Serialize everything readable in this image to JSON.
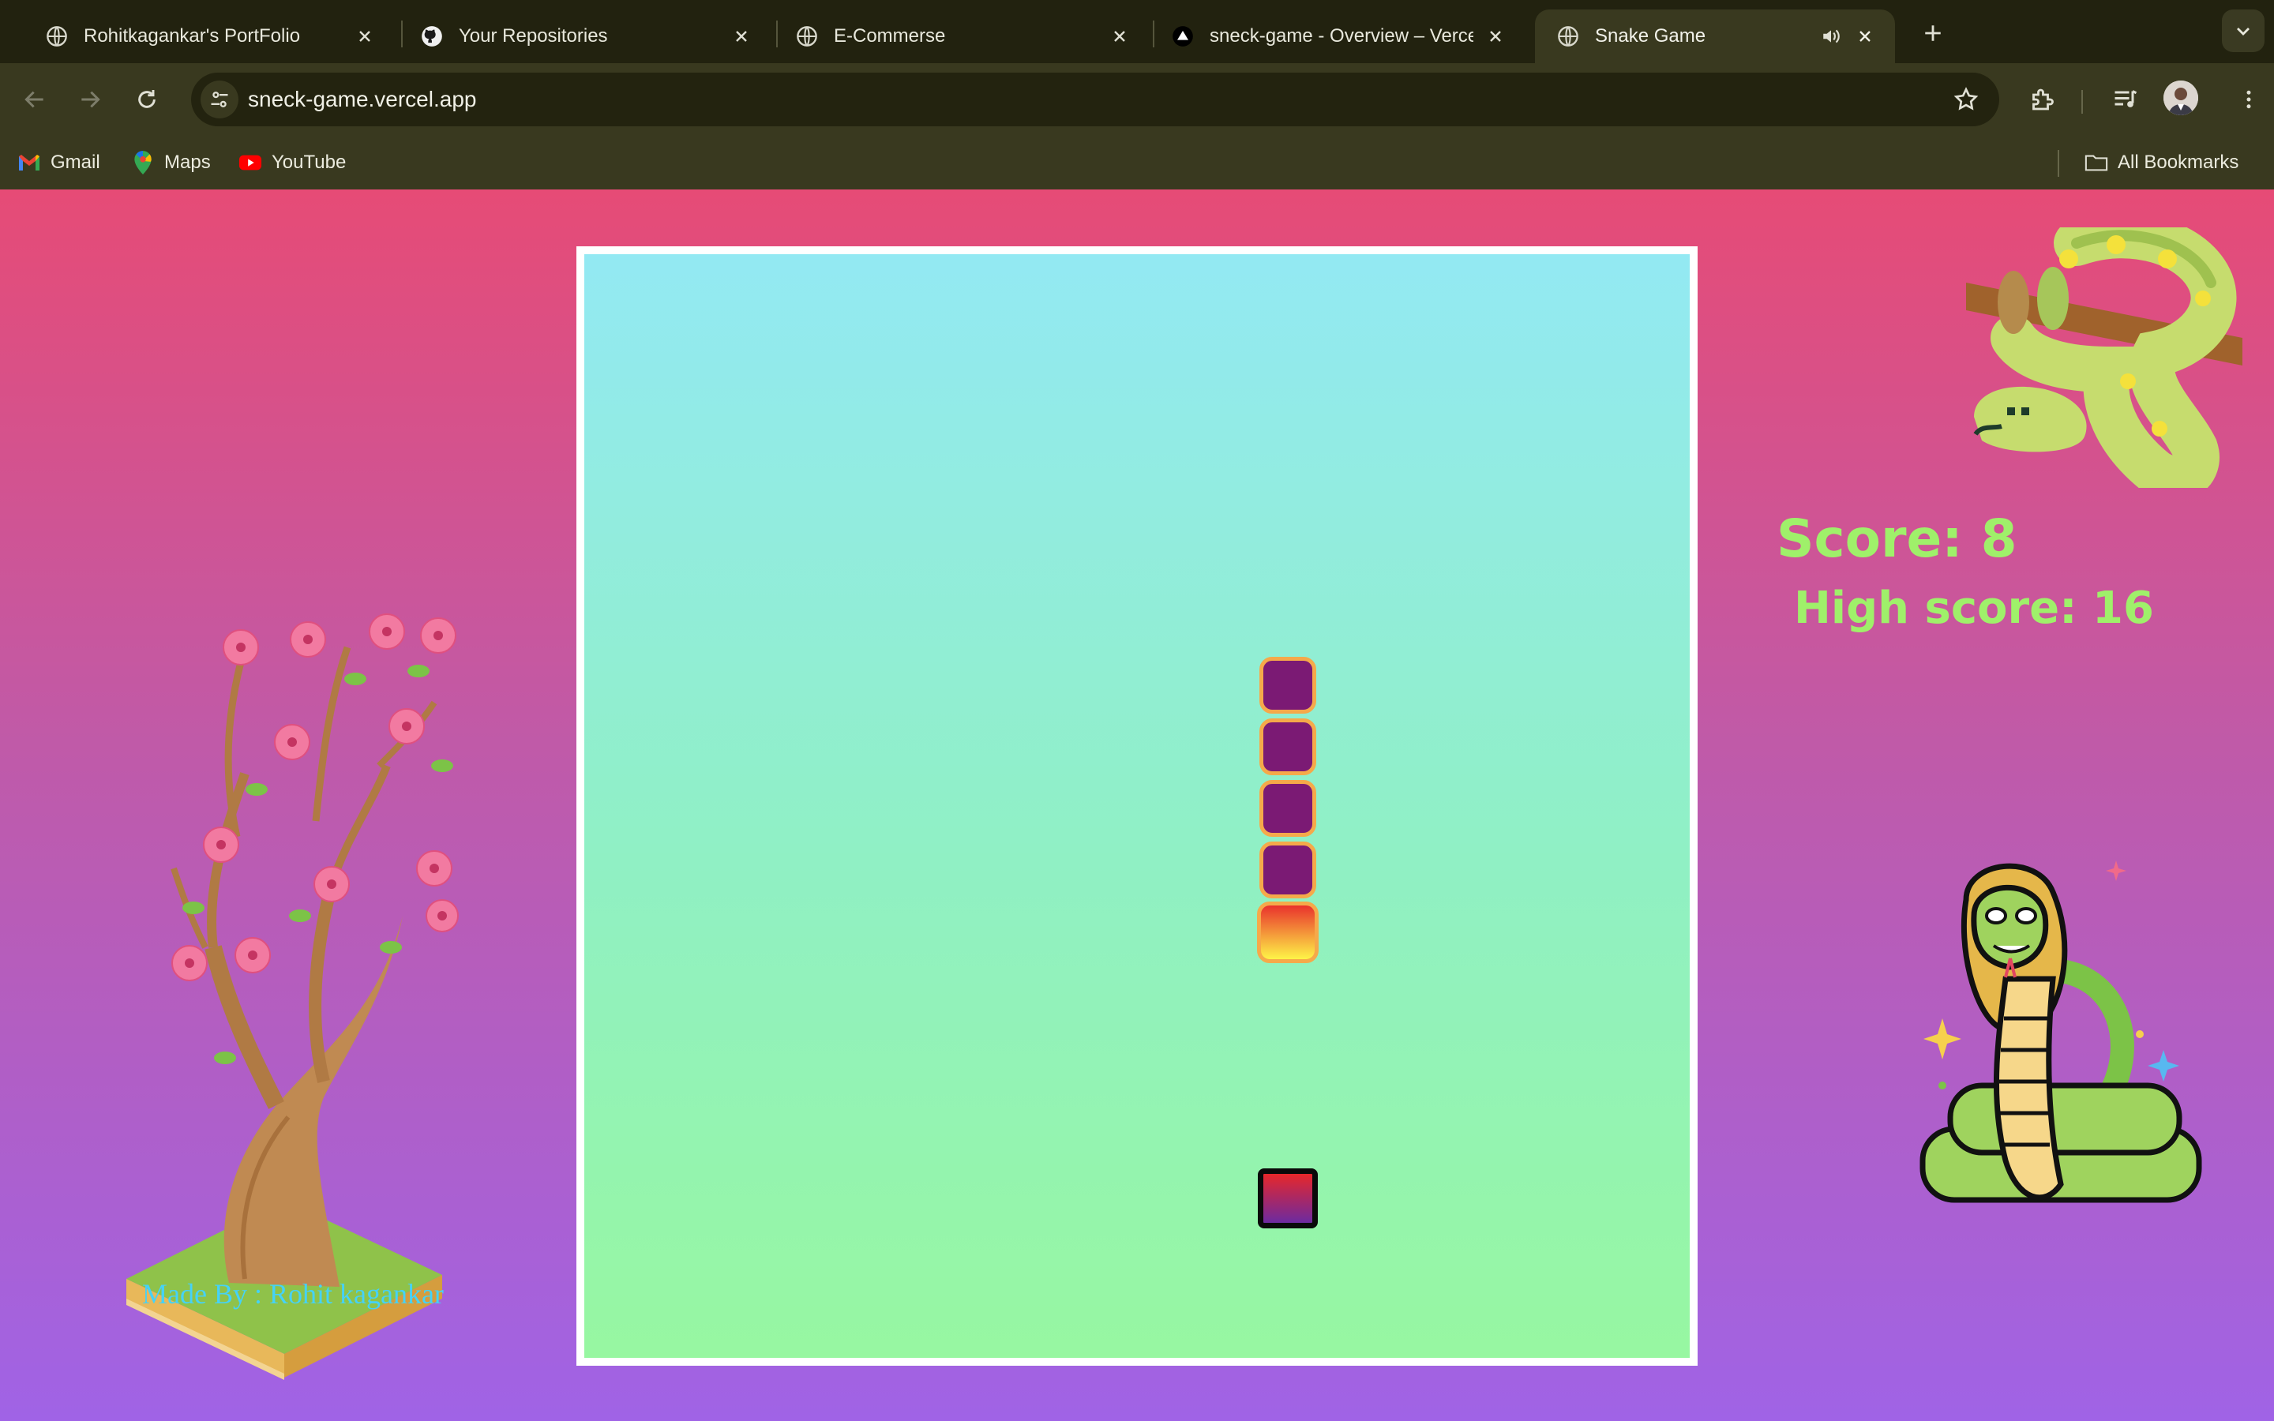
{
  "browser": {
    "tabs": [
      {
        "title": "Rohitkagankar's PortFolio",
        "favicon": "globe-icon",
        "active": false
      },
      {
        "title": "Your Repositories",
        "favicon": "github-icon",
        "active": false
      },
      {
        "title": "E-Commerse",
        "favicon": "globe-icon",
        "active": false
      },
      {
        "title": "sneck-game - Overview – Vercel",
        "favicon": "vercel-icon",
        "active": false
      },
      {
        "title": "Snake Game",
        "favicon": "globe-icon",
        "active": true,
        "audio": "speaker-icon"
      }
    ],
    "url": "sneck-game.vercel.app",
    "bookmarks": [
      {
        "label": "Gmail",
        "icon": "gmail-icon"
      },
      {
        "label": "Maps",
        "icon": "maps-icon"
      },
      {
        "label": "YouTube",
        "icon": "youtube-icon"
      }
    ],
    "all_bookmarks": "All Bookmarks"
  },
  "game": {
    "score_text": "Score: 8",
    "high_score_text": "High score: 16",
    "score": 8,
    "high_score": 16,
    "credit": "Made By : Rohit kagankar"
  },
  "colors": {
    "score": "#9ff06a",
    "credit": "#45d2f7",
    "snake_body": "#7b1a74",
    "snake_border": "#f5a94a"
  }
}
